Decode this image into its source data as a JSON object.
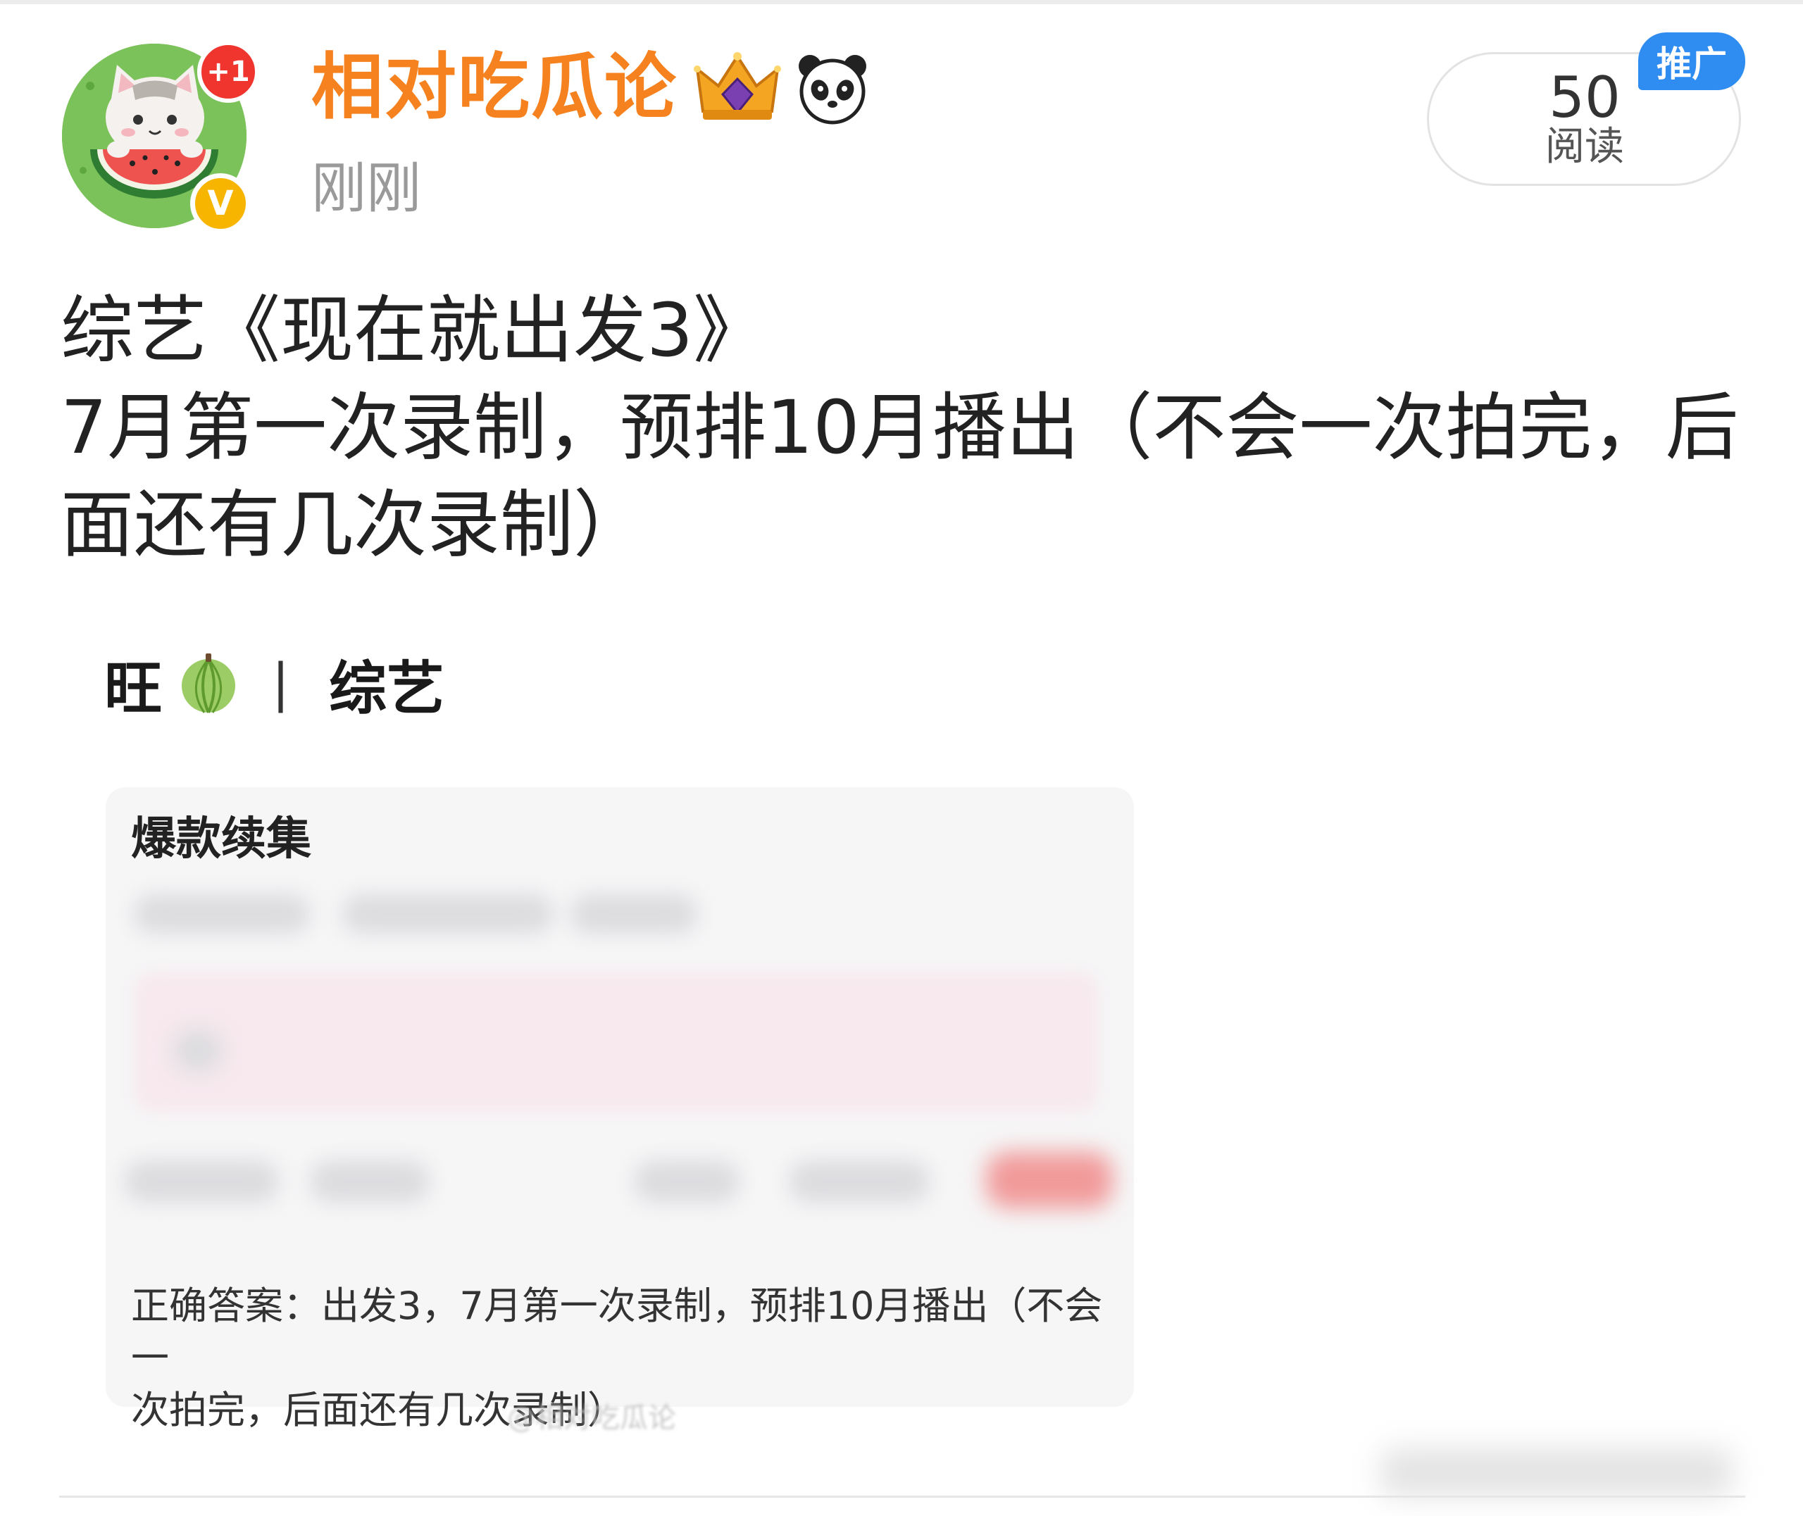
{
  "header": {
    "username": "相对吃瓜论",
    "timestamp": "刚刚",
    "notification_badge": "+1",
    "verified_mark": "V",
    "icons": [
      "crown-icon",
      "panda-icon"
    ],
    "colors": {
      "username": "#f5821f",
      "notification": "#f0352f",
      "verified": "#f7b500",
      "promo": "#2f8cf0"
    }
  },
  "stats": {
    "read_count": "50",
    "read_label": "阅读",
    "promo_tag": "推广"
  },
  "post": {
    "lines": [
      "综艺《现在就出发3》",
      "7月第一次录制，预排10月播出（不会一次拍完，后",
      "面还有几次录制）"
    ]
  },
  "embed": {
    "header_left": "旺",
    "separator": "|",
    "header_right": "综艺",
    "card_title": "爆款续集",
    "answer_lines": [
      "正确答案：出发3，7月第一次录制，预排10月播出（不会一",
      "次拍完，后面还有几次录制）"
    ],
    "watermark": "@相对吃瓜论"
  }
}
